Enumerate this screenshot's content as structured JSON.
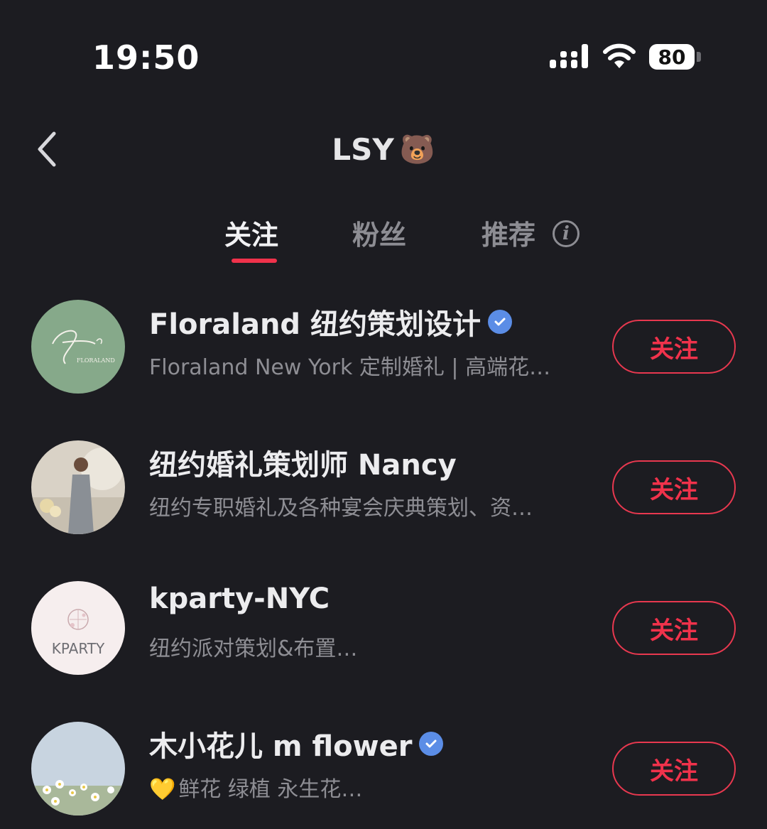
{
  "status_bar": {
    "time": "19:50",
    "battery": "80",
    "icons": [
      "signal-icon",
      "wifi-icon",
      "battery-icon"
    ]
  },
  "header": {
    "title": "LSY",
    "title_emoji": "🐻",
    "back_icon": "chevron-left-icon"
  },
  "tabs": [
    {
      "label": "关注",
      "active": true
    },
    {
      "label": "粉丝",
      "active": false
    },
    {
      "label": "推荐",
      "active": false
    }
  ],
  "info_icon": "i",
  "accounts": [
    {
      "name": "Floraland 纽约策划设计",
      "verified": true,
      "description": "Floraland New York 定制婚礼 | 高端花…",
      "button": "关注",
      "avatar": "floraland-logo",
      "avatar_text": "FLORALAND"
    },
    {
      "name": "纽约婚礼策划师 Nancy",
      "verified": false,
      "description": "纽约专职婚礼及各种宴会庆典策划、资…",
      "button": "关注",
      "avatar": "person-photo"
    },
    {
      "name": "kparty-NYC",
      "verified": false,
      "description": "纽约派对策划&布置…",
      "button": "关注",
      "avatar": "kparty-logo",
      "avatar_text": "KPARTY"
    },
    {
      "name": "木小花儿 m flower",
      "verified": true,
      "description_emoji": "💛",
      "description": "鲜花 绿植 永生花…",
      "button": "关注",
      "avatar": "daisy-photo"
    }
  ],
  "colors": {
    "background": "#1c1c21",
    "accent": "#f0324b",
    "verified": "#5b8de6"
  }
}
